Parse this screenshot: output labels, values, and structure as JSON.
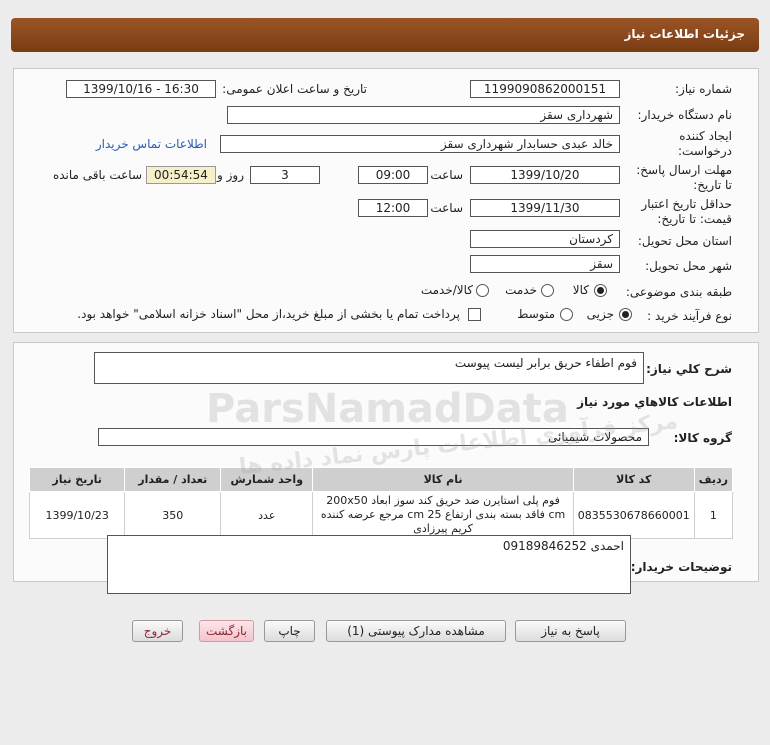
{
  "header": {
    "title": "جزئیات اطلاعات نیاز"
  },
  "form": {
    "need_number_label": "شماره نیاز:",
    "need_number": "1199090862000151",
    "announce_label": "تاریخ و ساعت اعلان عمومی:",
    "announce_value": "1399/10/16 - 16:30",
    "buyer_org_label": "نام دستگاه خریدار:",
    "buyer_org": "شهرداری سقز",
    "creator_label_1": "ایجاد کننده",
    "creator_label_2": "درخواست:",
    "creator": "خالد عبدی حسابدار شهرداری سقز",
    "buyer_contact_link": "اطلاعات تماس خریدار",
    "reply_deadline_label_1": "مهلت ارسال پاسخ:",
    "reply_deadline_label_2": "تا تاریخ:",
    "reply_date": "1399/10/20",
    "time_label": "ساعت",
    "reply_time": "09:00",
    "days_value": "3",
    "days_label": "روز و",
    "remaining_time": "00:54:54",
    "remaining_label": "ساعت باقی مانده",
    "validity_label_1": "حداقل تاریخ اعتبار",
    "validity_label_2": "قیمت: تا تاریخ:",
    "validity_date": "1399/11/30",
    "validity_time_label": "ساعت",
    "validity_time": "12:00",
    "province_label": "استان محل تحویل:",
    "province": "کردستان",
    "city_label": "شهر محل تحویل:",
    "city": "سقز",
    "category_label": "طبقه بندی موضوعی:",
    "category_options": [
      "کالا",
      "خدمت",
      "کالا/خدمت"
    ],
    "purchase_type_label": "نوع فرآیند خرید :",
    "purchase_options": [
      "جزیی",
      "متوسط"
    ],
    "payment_note": "پرداخت تمام یا بخشی از مبلغ خرید،از محل \"اسناد خزانه اسلامی\" خواهد بود."
  },
  "details": {
    "summary_label": "شرح کلي نياز:",
    "summary": "فوم اطفاء حریق برابر لیست پیوست",
    "goods_info_title": "اطلاعات کالاهاي مورد نياز",
    "goods_group_label": "گروه کالا:",
    "goods_group": "محصولات شیمیائی",
    "table": {
      "headers": [
        "ردیف",
        "کد کالا",
        "نام کالا",
        "واحد شمارش",
        "تعداد / مقدار",
        "تاریخ نیاز"
      ],
      "rows": [
        {
          "row": "1",
          "code": "0835530678660001",
          "name": "فوم پلی استایرن ضد حریق کند سوز ابعاد 200x50 cm فاقد بسته بندی ارتفاع 25 cm مرجع عرضه کننده کریم پیرزادی",
          "unit": "عدد",
          "qty": "350",
          "date": "1399/10/23"
        }
      ]
    },
    "buyer_notes_label": "توضیحات خریدار:",
    "buyer_notes": "احمدی 09189846252"
  },
  "buttons": {
    "reply": "پاسخ به نیاز",
    "view_docs": "مشاهده مدارک پیوستی (1)",
    "print": "چاپ",
    "back": "بازگشت",
    "exit": "خروج"
  },
  "watermark": {
    "brand": "ParsNamadData",
    "persian": "مرکز فرآوری اطلاعات پارس نماد داده ها"
  }
}
